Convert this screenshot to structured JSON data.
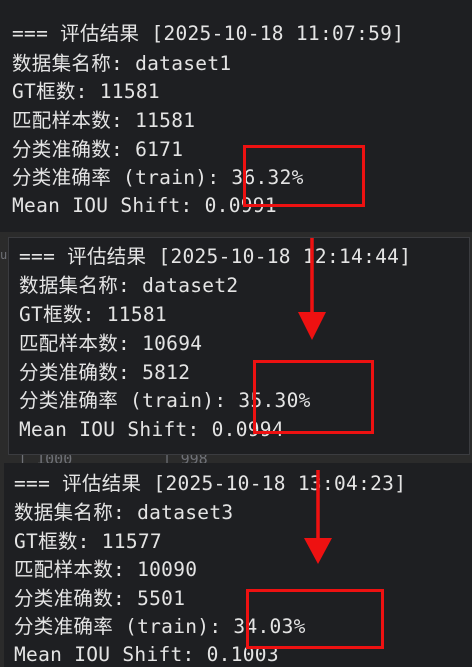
{
  "results": [
    {
      "header": "=== 评估结果 [2025-10-18 11:07:59]",
      "dataset": "数据集名称: dataset1",
      "gt": "GT框数: 11581",
      "matched": "匹配样本数: 11581",
      "correct": "分类准确数: 6171",
      "acc_label": "分类准确率 (train): ",
      "acc_value": "36.32%",
      "iou": "Mean IOU Shift: 0.0991"
    },
    {
      "header": "=== 评估结果 [2025-10-18 12:14:44]",
      "dataset": "数据集名称: dataset2",
      "gt": "GT框数: 11581",
      "matched": "匹配样本数: 10694",
      "correct": "分类准确数: 5812",
      "acc_label": "分类准确率 (train): ",
      "acc_value": "35.30%",
      "iou": "Mean IOU Shift: 0.0994"
    },
    {
      "header": "=== 评估结果 [2025-10-18 13:04:23]",
      "dataset": "数据集名称: dataset3",
      "gt": "GT框数: 11577",
      "matched": "匹配样本数: 10090",
      "correct": "分类准确数: 5501",
      "acc_label": "分类准确率 (train): ",
      "acc_value": "34.03%",
      "iou": "Mean IOU Shift: 0.1003"
    }
  ],
  "background": {
    "table_fragment": "  | 1000          | 998"
  },
  "colors": {
    "terminal_bg": "#1e1f22",
    "text": "#e4e4e4",
    "annotation": "#ee1111"
  },
  "icons": [
    "arrow-down-icon",
    "arrow-down-icon"
  ]
}
